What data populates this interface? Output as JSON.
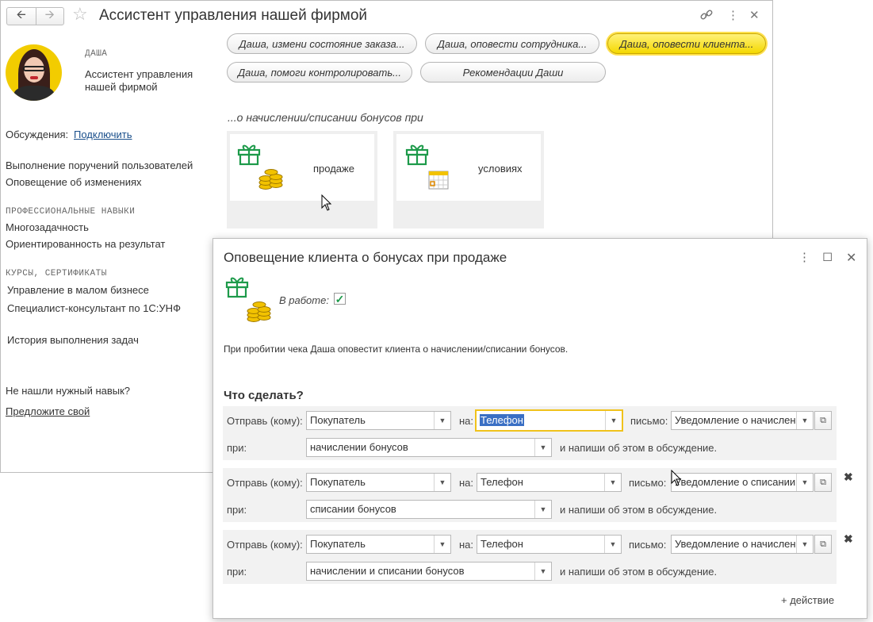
{
  "window": {
    "title": "Ассистент управления нашей фирмой"
  },
  "assistant": {
    "name": "ДАША",
    "role": "Ассистент управления нашей фирмой",
    "role_line1": "Ассистент управления",
    "role_line2": "нашей фирмой"
  },
  "sidebar": {
    "discussions_label": "Обсуждения:",
    "discussions_link": "Подключить",
    "items": [
      "Выполнение поручений пользователей",
      "Оповещение об изменениях"
    ],
    "skills_header": "ПРОФЕССИОНАЛЬНЫЕ НАВЫКИ",
    "skills": [
      "Многозадачность",
      "Ориентированность на результат"
    ],
    "courses_header": "КУРСЫ, СЕРТИФИКАТЫ",
    "courses": [
      "Управление в малом бизнесе",
      "Специалист-консультант по 1С:УНФ"
    ],
    "history": "История выполнения задач",
    "not_found": "Не нашли нужный навык?",
    "suggest_link": "Предложите свой"
  },
  "actions": [
    {
      "label": "Даша, измени состояние заказа...",
      "active": false
    },
    {
      "label": "Даша, оповести сотрудника...",
      "active": false
    },
    {
      "label": "Даша, оповести клиента...",
      "active": true
    },
    {
      "label": "Даша, помоги контролировать...",
      "active": false
    },
    {
      "label": "Рекомендации Даши",
      "active": false
    }
  ],
  "section_heading": "...о начислении/списании бонусов при",
  "tiles": [
    {
      "label": "продаже",
      "icons": [
        "gift-icon",
        "coins-icon"
      ]
    },
    {
      "label": "условиях",
      "icons": [
        "gift-icon",
        "calendar-icon"
      ]
    }
  ],
  "dialog": {
    "title": "Оповещение клиента о бонусах при продаже",
    "in_work_label": "В работе:",
    "in_work_checked": true,
    "description": "При пробитии чека Даша оповестит клиента о начислении/списании бонусов.",
    "what_to_do": "Что сделать?",
    "labels": {
      "send_to": "Отправь (кому):",
      "to": "на:",
      "letter": "письмо:",
      "when": "при:",
      "and_write": "и напиши об этом в обсуждение."
    },
    "rules": [
      {
        "recipient": "Покупатель",
        "channel": "Телефон",
        "message": "Уведомление о начислени",
        "event": "начислении бонусов",
        "removable": false
      },
      {
        "recipient": "Покупатель",
        "channel": "Телефон",
        "message": "Уведомление о списании",
        "event": "списании бонусов",
        "removable": true
      },
      {
        "recipient": "Покупатель",
        "channel": "Телефон",
        "message": "Уведомление о начислени",
        "event": "начислении и списании бонусов",
        "removable": true
      }
    ],
    "add_action": "+ действие"
  },
  "colors": {
    "active_pill": "#f4d800",
    "gift_green": "#1d9a4a",
    "coin_gold": "#e0b000",
    "link_blue": "#1a4f8b",
    "selection": "#3a6fc4",
    "focus_border": "#f0c21b"
  }
}
